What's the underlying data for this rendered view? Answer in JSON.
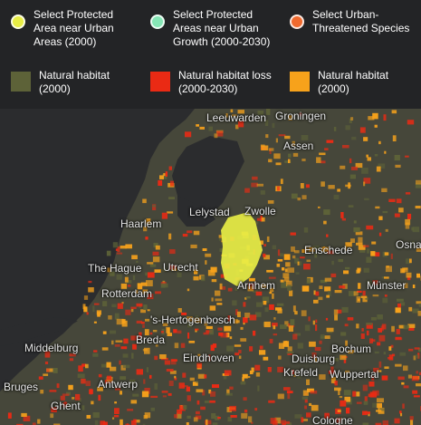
{
  "legend": {
    "selectors": [
      {
        "label": "Select Protected\nArea near Urban\nAreas (2000)",
        "color": "#e8ee45"
      },
      {
        "label": "Select Protected\nAreas near Urban\nGrowth (2000-2030)",
        "color": "#86e7b6"
      },
      {
        "label": "Select Urban-\nThreatened Species",
        "color": "#f06a2e"
      }
    ],
    "swatches": [
      {
        "label": "Natural habitat\n(2000)",
        "color": "#5d6238"
      },
      {
        "label": "Natural habitat loss\n(2000-2030)",
        "color": "#ea2a14"
      },
      {
        "label": "Natural habitat\n(2000)",
        "color": "#f7a21b"
      }
    ]
  },
  "colors": {
    "water": "#2b2c2e",
    "land": "#46473a",
    "habitat": "#5d6238",
    "habitat_loss": "#ea2a14",
    "habitat_2000": "#f7a21b",
    "selected_area": "#e8ee45"
  },
  "cities": [
    "Leeuwarden",
    "Groningen",
    "Assen",
    "Lelystad",
    "Zwolle",
    "Haarlem",
    "Enschede",
    "Osnabr",
    "The Hague",
    "Utrecht",
    "Rotterdam",
    "Arnhem",
    "Münster",
    "'s-Hertogenbosch",
    "Breda",
    "Bochum",
    "Middelburg",
    "Eindhoven",
    "Duisburg",
    "Krefeld",
    "Wuppertal",
    "Bruges",
    "Antwerp",
    "Ghent",
    "Cologne"
  ]
}
